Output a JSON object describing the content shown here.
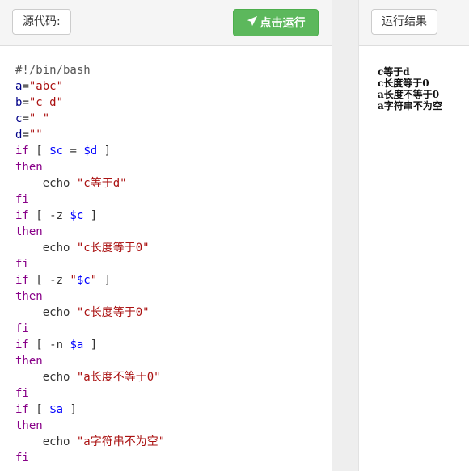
{
  "source_panel": {
    "label": "源代码:",
    "run_button": "点击运行",
    "code_lines": [
      [
        {
          "t": "#!/bin/bash",
          "c": "cmt"
        }
      ],
      [
        {
          "t": "a",
          "c": "kw2"
        },
        {
          "t": "=",
          "c": "plain"
        },
        {
          "t": "\"abc\"",
          "c": "str"
        }
      ],
      [
        {
          "t": "b",
          "c": "kw2"
        },
        {
          "t": "=",
          "c": "plain"
        },
        {
          "t": "\"c d\"",
          "c": "str"
        }
      ],
      [
        {
          "t": "c",
          "c": "kw2"
        },
        {
          "t": "=",
          "c": "plain"
        },
        {
          "t": "\" \"",
          "c": "str"
        }
      ],
      [
        {
          "t": "d",
          "c": "kw2"
        },
        {
          "t": "=",
          "c": "plain"
        },
        {
          "t": "\"\"",
          "c": "str"
        }
      ],
      [
        {
          "t": "if",
          "c": "kw"
        },
        {
          "t": " [ ",
          "c": "plain"
        },
        {
          "t": "$c",
          "c": "var"
        },
        {
          "t": " = ",
          "c": "plain"
        },
        {
          "t": "$d",
          "c": "var"
        },
        {
          "t": " ]",
          "c": "plain"
        }
      ],
      [
        {
          "t": "then",
          "c": "kw"
        }
      ],
      [
        {
          "t": "    echo ",
          "c": "plain"
        },
        {
          "t": "\"c等于d\"",
          "c": "str"
        }
      ],
      [
        {
          "t": "fi",
          "c": "kw"
        }
      ],
      [
        {
          "t": "if",
          "c": "kw"
        },
        {
          "t": " [ -z ",
          "c": "plain"
        },
        {
          "t": "$c",
          "c": "var"
        },
        {
          "t": " ]",
          "c": "plain"
        }
      ],
      [
        {
          "t": "then",
          "c": "kw"
        }
      ],
      [
        {
          "t": "    echo ",
          "c": "plain"
        },
        {
          "t": "\"c长度等于0\"",
          "c": "str"
        }
      ],
      [
        {
          "t": "fi",
          "c": "kw"
        }
      ],
      [
        {
          "t": "if",
          "c": "kw"
        },
        {
          "t": " [ -z ",
          "c": "plain"
        },
        {
          "t": "\"",
          "c": "str"
        },
        {
          "t": "$c",
          "c": "var"
        },
        {
          "t": "\"",
          "c": "str"
        },
        {
          "t": " ]",
          "c": "plain"
        }
      ],
      [
        {
          "t": "then",
          "c": "kw"
        }
      ],
      [
        {
          "t": "    echo ",
          "c": "plain"
        },
        {
          "t": "\"c长度等于0\"",
          "c": "str"
        }
      ],
      [
        {
          "t": "fi",
          "c": "kw"
        }
      ],
      [
        {
          "t": "if",
          "c": "kw"
        },
        {
          "t": " [ -n ",
          "c": "plain"
        },
        {
          "t": "$a",
          "c": "var"
        },
        {
          "t": " ]",
          "c": "plain"
        }
      ],
      [
        {
          "t": "then",
          "c": "kw"
        }
      ],
      [
        {
          "t": "    echo ",
          "c": "plain"
        },
        {
          "t": "\"a长度不等于0\"",
          "c": "str"
        }
      ],
      [
        {
          "t": "fi",
          "c": "kw"
        }
      ],
      [
        {
          "t": "if",
          "c": "kw"
        },
        {
          "t": " [ ",
          "c": "plain"
        },
        {
          "t": "$a",
          "c": "var"
        },
        {
          "t": " ]",
          "c": "plain"
        }
      ],
      [
        {
          "t": "then",
          "c": "kw"
        }
      ],
      [
        {
          "t": "    echo ",
          "c": "plain"
        },
        {
          "t": "\"a字符串不为空\"",
          "c": "str"
        }
      ],
      [
        {
          "t": "fi",
          "c": "kw"
        }
      ]
    ]
  },
  "result_panel": {
    "label": "运行结果",
    "output_lines": [
      "c等于d",
      "c长度等于0",
      "a长度不等于0",
      "a字符串不为空"
    ]
  },
  "colors": {
    "run_button": "#5cb85c",
    "keyword": "#880088",
    "string": "#aa1111",
    "variable": "#0000ff"
  },
  "icons": {
    "run_icon": "paper-plane-icon"
  }
}
